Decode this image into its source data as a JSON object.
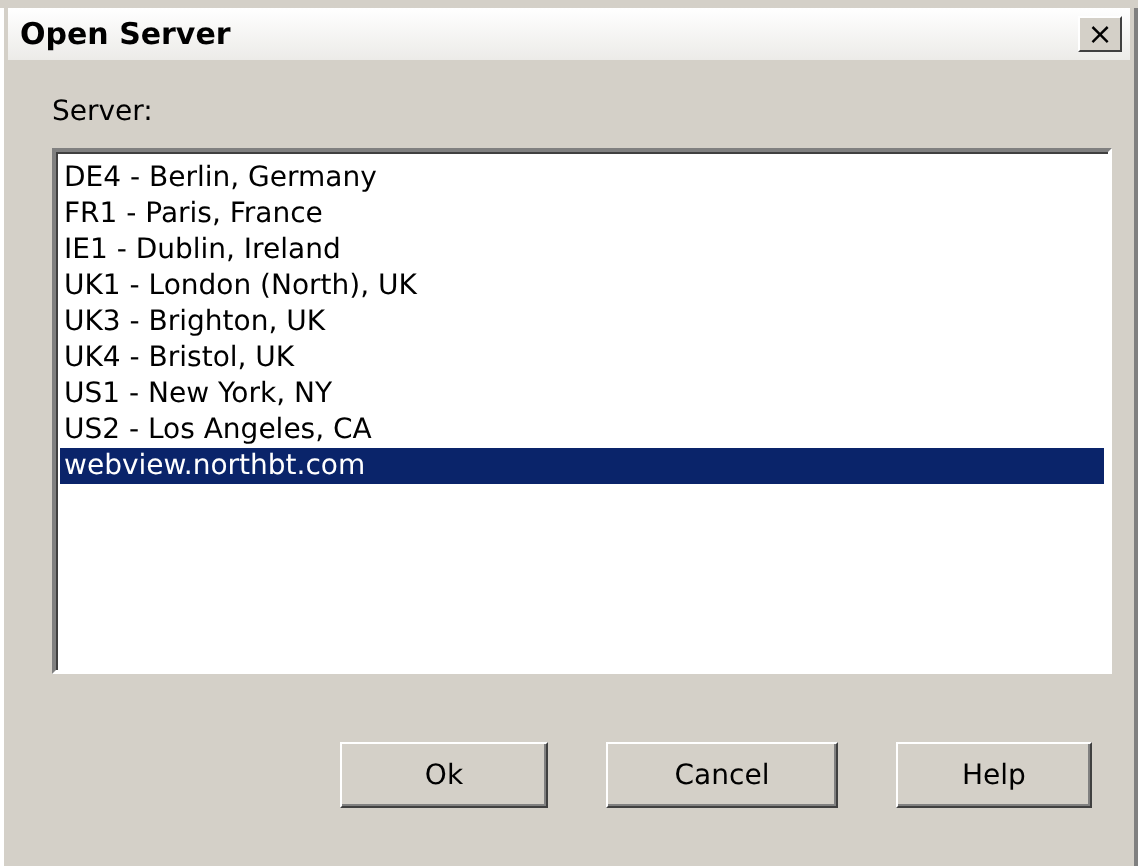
{
  "window": {
    "title": "Open Server",
    "close": "×"
  },
  "server_label": "Server:",
  "servers": [
    {
      "label": "DE4 - Berlin, Germany",
      "selected": false
    },
    {
      "label": "FR1 - Paris, France",
      "selected": false
    },
    {
      "label": "IE1 - Dublin, Ireland",
      "selected": false
    },
    {
      "label": "UK1 - London (North), UK",
      "selected": false
    },
    {
      "label": "UK3 - Brighton, UK",
      "selected": false
    },
    {
      "label": "UK4 - Bristol, UK",
      "selected": false
    },
    {
      "label": "US1 - New York, NY",
      "selected": false
    },
    {
      "label": "US2 - Los Angeles, CA",
      "selected": false
    },
    {
      "label": "webview.northbt.com",
      "selected": true
    }
  ],
  "buttons": [
    "Ok",
    "Cancel",
    "Help"
  ]
}
